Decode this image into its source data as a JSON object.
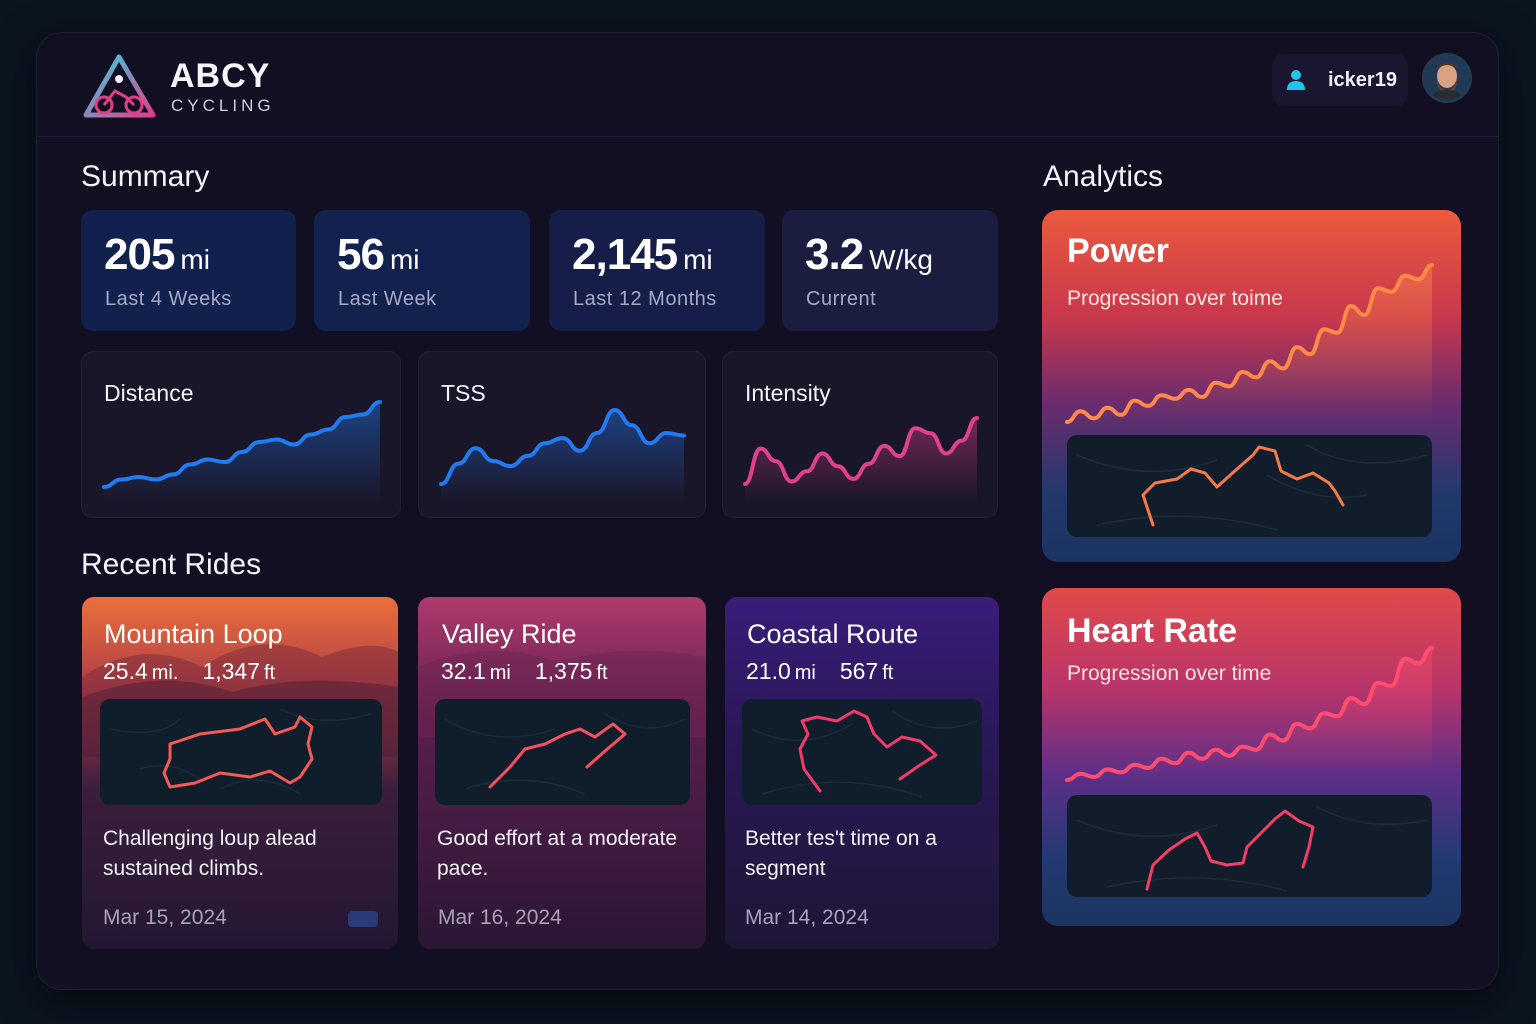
{
  "brand": {
    "name": "ABCY",
    "subtitle": "CYCLING"
  },
  "user": {
    "username": "icker19",
    "icon": "user-icon",
    "avatar": "avatar-photo"
  },
  "summary": {
    "title": "Summary",
    "stats": [
      {
        "value": "205",
        "unit": "mi",
        "label": "Last 4 Weeks"
      },
      {
        "value": "56",
        "unit": "mi",
        "label": "Last Week"
      },
      {
        "value": "2,145",
        "unit": "mi",
        "label": "Last 12 Months"
      },
      {
        "value": "3.2",
        "unit": "W/kg",
        "label": "Current"
      }
    ]
  },
  "trends": [
    {
      "title": "Distance",
      "color": "#1f7cf2",
      "values": [
        2,
        5,
        6,
        5,
        7,
        11,
        13,
        12,
        16,
        20,
        21,
        19,
        23,
        25,
        30,
        31,
        36
      ]
    },
    {
      "title": "TSS",
      "color": "#2479f0",
      "values": [
        2,
        10,
        16,
        11,
        9,
        13,
        18,
        20,
        15,
        22,
        31,
        25,
        18,
        22,
        21
      ]
    },
    {
      "title": "Intensity",
      "color": "#e0408e",
      "values": [
        8,
        22,
        17,
        9,
        13,
        20,
        15,
        10,
        16,
        23,
        19,
        30,
        28,
        20,
        25,
        34
      ]
    }
  ],
  "recent_rides": {
    "title": "Recent Rides",
    "rides": [
      {
        "name": "Mountain Loop",
        "distance": "25.4",
        "distance_unit": "mi.",
        "elevation": "1,347",
        "elevation_unit": "ft",
        "description": "Challenging loup alead sustained climbs.",
        "date": "Mar 15, 2024",
        "route_color": "#f45a55"
      },
      {
        "name": "Valley Ride",
        "distance": "32.1",
        "distance_unit": "mi",
        "elevation": "1,375",
        "elevation_unit": "ft",
        "description": "Good effort at a moderate pace.",
        "date": "Mar 16, 2024",
        "route_color": "#f5505e"
      },
      {
        "name": "Coastal Route",
        "distance": "21.0",
        "distance_unit": "mi",
        "elevation": "567",
        "elevation_unit": "ft",
        "description": "Better tes't time on a segment",
        "date": "Mar 14, 2024",
        "route_color": "#f23a6c"
      }
    ]
  },
  "analytics": {
    "title": "Analytics",
    "cards": [
      {
        "title": "Power",
        "subtitle": "Progression over toime",
        "line_color": "#ff8a4a",
        "route_color": "#f57a48",
        "values": [
          10,
          16,
          12,
          18,
          14,
          22,
          19,
          25,
          23,
          28,
          24,
          32,
          30,
          38,
          35,
          44,
          40,
          52,
          48,
          62,
          60,
          75,
          70,
          85,
          83,
          92,
          90,
          98
        ]
      },
      {
        "title": "Heart Rate",
        "subtitle": "Progression over time",
        "line_color": "#ff4d72",
        "route_color": "#f53d66",
        "values": [
          8,
          12,
          10,
          15,
          13,
          18,
          16,
          22,
          19,
          26,
          22,
          28,
          24,
          30,
          28,
          38,
          34,
          45,
          42,
          52,
          50,
          62,
          58,
          72,
          70,
          88,
          85,
          95
        ]
      }
    ]
  }
}
